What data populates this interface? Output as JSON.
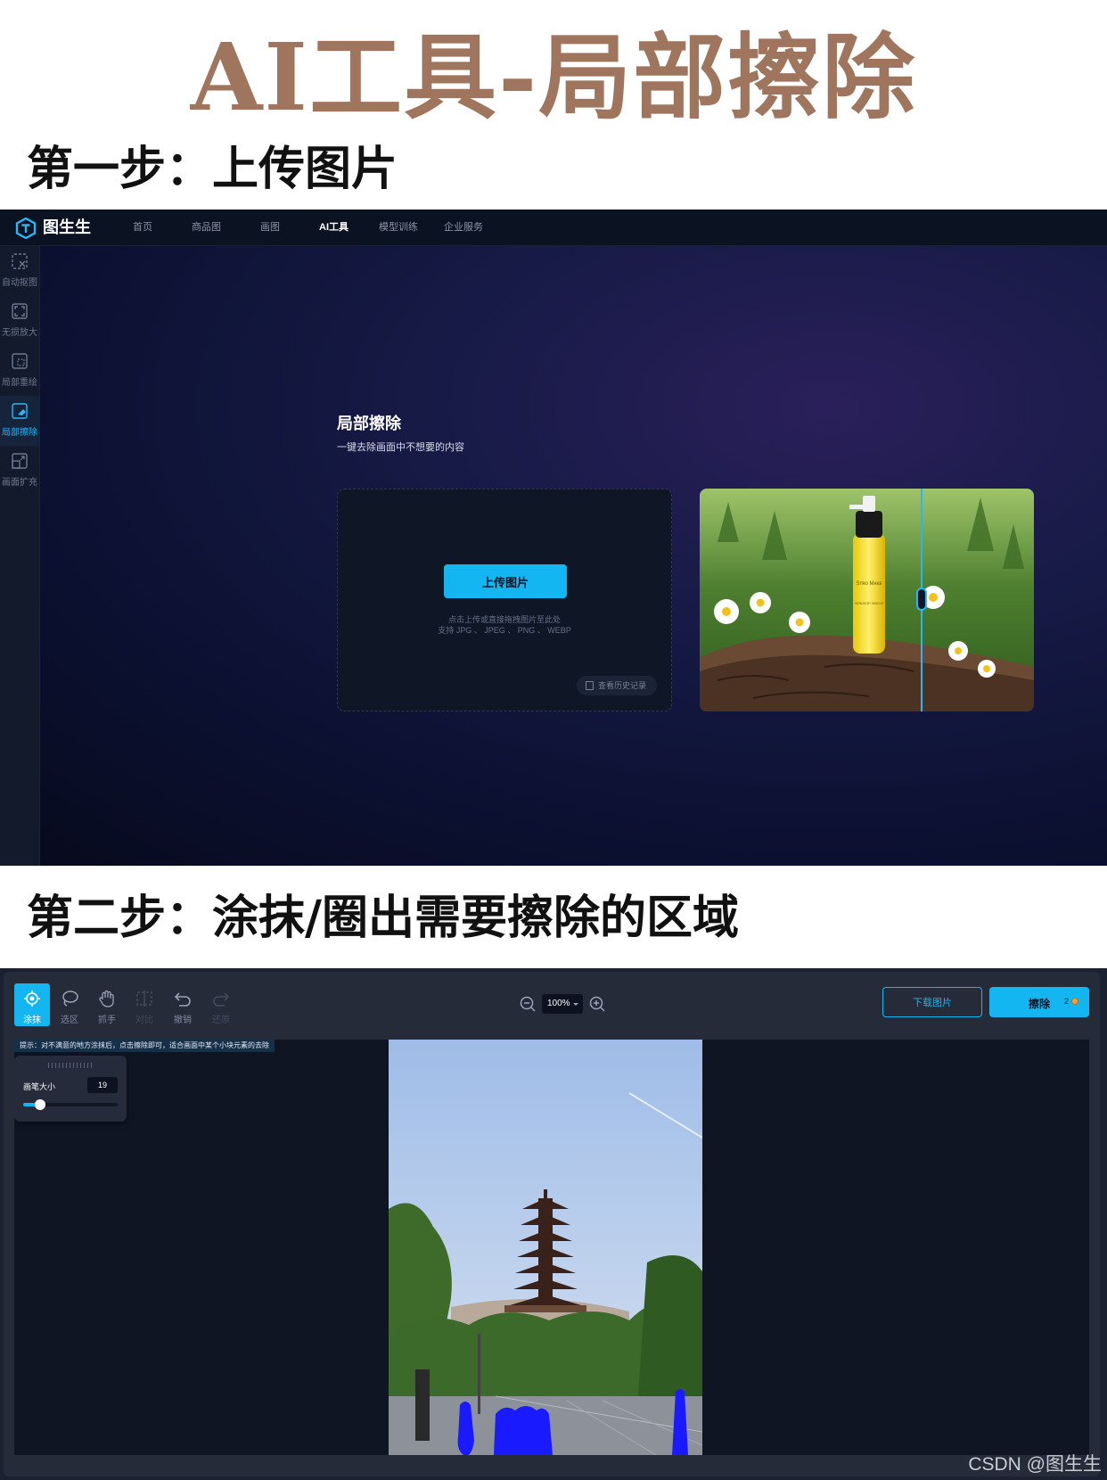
{
  "main_title": "AI工具-局部擦除",
  "step1_title": "第一步：上传图片",
  "step2_title": "第二步：涂抹/圈出需要擦除的区域",
  "watermark": "CSDN @图生生",
  "colors": {
    "title_brown": "#a0755e",
    "accent_blue": "#13b6f0",
    "mask_blue": "#1a1aff",
    "dark_bg": "#0b1222"
  },
  "screen1": {
    "logo_text": "图生生",
    "logo_icon": "t-hexagon-logo-icon",
    "nav": [
      {
        "label": "首页",
        "active": false
      },
      {
        "label": "商品图",
        "active": false
      },
      {
        "label": "画图",
        "active": false
      },
      {
        "label": "AI工具",
        "active": true
      },
      {
        "label": "模型训练",
        "active": false
      },
      {
        "label": "企业服务",
        "active": false
      }
    ],
    "sidebar": [
      {
        "label": "自动抠图",
        "icon": "cutout-icon",
        "active": false
      },
      {
        "label": "无损放大",
        "icon": "upscale-icon",
        "active": false
      },
      {
        "label": "局部重绘",
        "icon": "repaint-icon",
        "active": false
      },
      {
        "label": "局部擦除",
        "icon": "eraser-icon",
        "active": true
      },
      {
        "label": "画面扩充",
        "icon": "expand-icon",
        "active": false
      }
    ],
    "feature_title": "局部擦除",
    "feature_subtitle": "一键去除画面中不想要的内容",
    "upload_button": "上传图片",
    "upload_hint_1": "点击上传或直接拖拽图片至此处",
    "upload_hint_2": "支持 JPG 、 JPEG 、 PNG 、 WEBP",
    "history_button": "查看历史记录",
    "preview_product_brand": "Sᴛʀᴏ Mᴀᴋᴇ",
    "preview_product_line": "SERUM BY SINGLE"
  },
  "screen2": {
    "tools": [
      {
        "label": "涂抹",
        "icon": "brush-icon",
        "active": true,
        "disabled": false
      },
      {
        "label": "选区",
        "icon": "lasso-icon",
        "active": false,
        "disabled": false
      },
      {
        "label": "抓手",
        "icon": "hand-icon",
        "active": false,
        "disabled": false
      },
      {
        "label": "对比",
        "icon": "compare-icon",
        "active": false,
        "disabled": true
      },
      {
        "label": "撤销",
        "icon": "undo-icon",
        "active": false,
        "disabled": false
      },
      {
        "label": "还原",
        "icon": "redo-icon",
        "active": false,
        "disabled": true
      }
    ],
    "zoom_value": "100%",
    "download_button": "下载图片",
    "erase_button": "擦除",
    "erase_cost": "2",
    "tip": "提示：对不满意的地方涂抹后，点击擦除即可，适合画面中某个小块元素的去除",
    "brush_label": "画笔大小",
    "brush_value": "19",
    "brush_fraction": 0.18
  }
}
